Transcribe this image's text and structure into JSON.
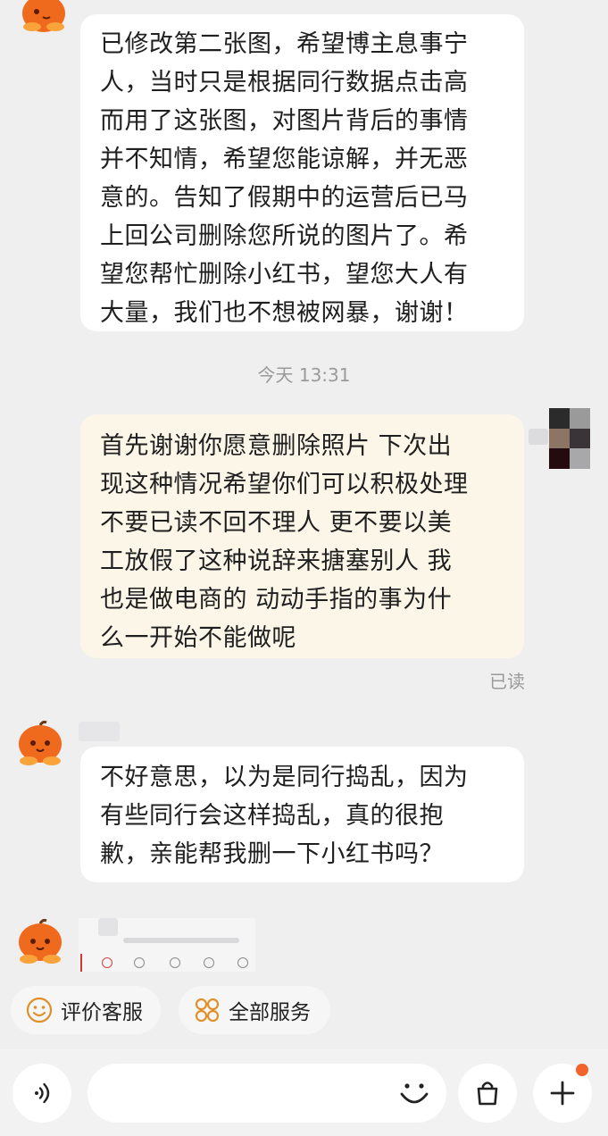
{
  "messages": {
    "msg1": "已修改第二张图，希望博主息事宁\n人，当时只是根据同行数据点击高\n而用了这张图，对图片背后的事情\n并不知情，希望您能谅解，并无恶\n意的。告知了假期中的运营后已马\n上回公司删除您所说的图片了。希\n望您帮忙删除小红书，望您大人有\n大量，我们也不想被网暴，谢谢！",
    "timestamp": "今天 13:31",
    "msg2": "首先谢谢你愿意删除照片 下次出\n现这种情况希望你们可以积极处理\n不要已读不回不理人 更不要以美\n工放假了这种说辞来搪塞别人 我\n也是做电商的 动动手指的事为什\n么一开始不能做呢",
    "read_status": "已读",
    "msg3": "不好意思，以为是同行捣乱，因为\n有些同行会这样捣乱，真的很抱\n歉，亲能帮我删一下小红书吗？"
  },
  "quick_actions": {
    "rate": "评价客服",
    "all_services": "全部服务"
  },
  "input_bar": {
    "placeholder": ""
  },
  "icons": {
    "shop_avatar": "pumpkin-avatar-icon",
    "voice": "voice-icon",
    "emoji": "emoji-icon",
    "bag": "shopping-bag-icon",
    "plus": "plus-icon",
    "rate": "smiley-icon",
    "services": "grid-services-icon"
  },
  "colors": {
    "accent_orange": "#f2642a",
    "incoming_bubble": "#ffffff",
    "outgoing_bubble": "#fcf6e9",
    "background": "#efeff0"
  }
}
